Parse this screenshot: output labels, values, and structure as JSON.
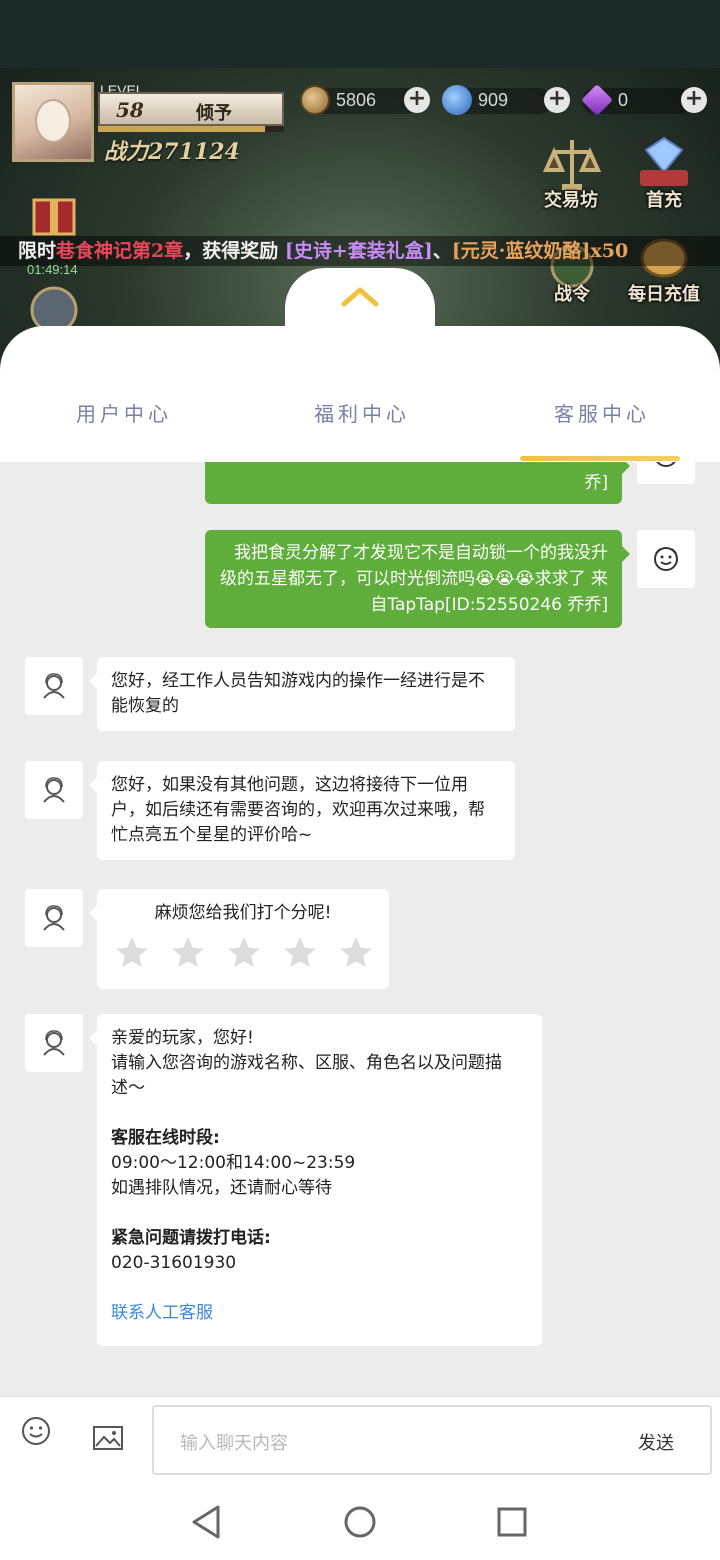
{
  "game": {
    "level_label": "LEVEL",
    "level": "58",
    "player_name": "倾予",
    "xp_fraction": 0.9,
    "power": "战力271124",
    "resources": [
      {
        "name": "coin",
        "value": "5806"
      },
      {
        "name": "gem-blue",
        "value": "909"
      },
      {
        "name": "diamond",
        "value": "0"
      }
    ],
    "menu": {
      "trade": "交易坊",
      "first_charge": "首充",
      "battle_pass": "战令",
      "daily_recharge": "每日充值"
    },
    "ticker": {
      "prefix": "限时",
      "chapter": "巷食神记第2章",
      "mid": "，获得奖励",
      "reward1": "[史诗+套装礼盒]",
      "sep": "、",
      "reward2": "[元灵·蓝纹奶酪]x50"
    },
    "timer": "01:49:14"
  },
  "panel": {
    "tabs": [
      {
        "label": "用户中心",
        "active": false
      },
      {
        "label": "福利中心",
        "active": false
      },
      {
        "label": "客服中心",
        "active": true
      }
    ],
    "accent": "#f0c040"
  },
  "chat": {
    "partial_msg_tail": "乔]",
    "user_msg": "我把食灵分解了才发现它不是自动锁一个的我没升级的五星都无了，可以时光倒流吗😭😭😭求求了 来自TapTap[ID:52550246 乔乔]",
    "agent_msg1": "您好，经工作人员告知游戏内的操作一经进行是不能恢复的",
    "agent_msg2": "您好，如果没有其他问题，这边将接待下一位用户，如后续还有需要咨询的，欢迎再次过来哦，帮忙点亮五个星星的评价哈~",
    "rating_prompt": "麻烦您给我们打个分呢!",
    "rating_stars": 5,
    "welcome": {
      "greeting": "亲爱的玩家，您好!",
      "instruction": "请输入您咨询的游戏名称、区服、角色名以及问题描述～",
      "hours_title": "客服在线时段:",
      "hours": "09:00～12:00和14:00~23:59",
      "queue_note": "如遇排队情况，还请耐心等待",
      "phone_title": "紧急问题请拨打电话:",
      "phone": "020-31601930",
      "contact_link": "联系人工客服"
    },
    "bubble_color": "#5fad3a"
  },
  "input": {
    "placeholder": "输入聊天内容",
    "send_label": "发送"
  }
}
